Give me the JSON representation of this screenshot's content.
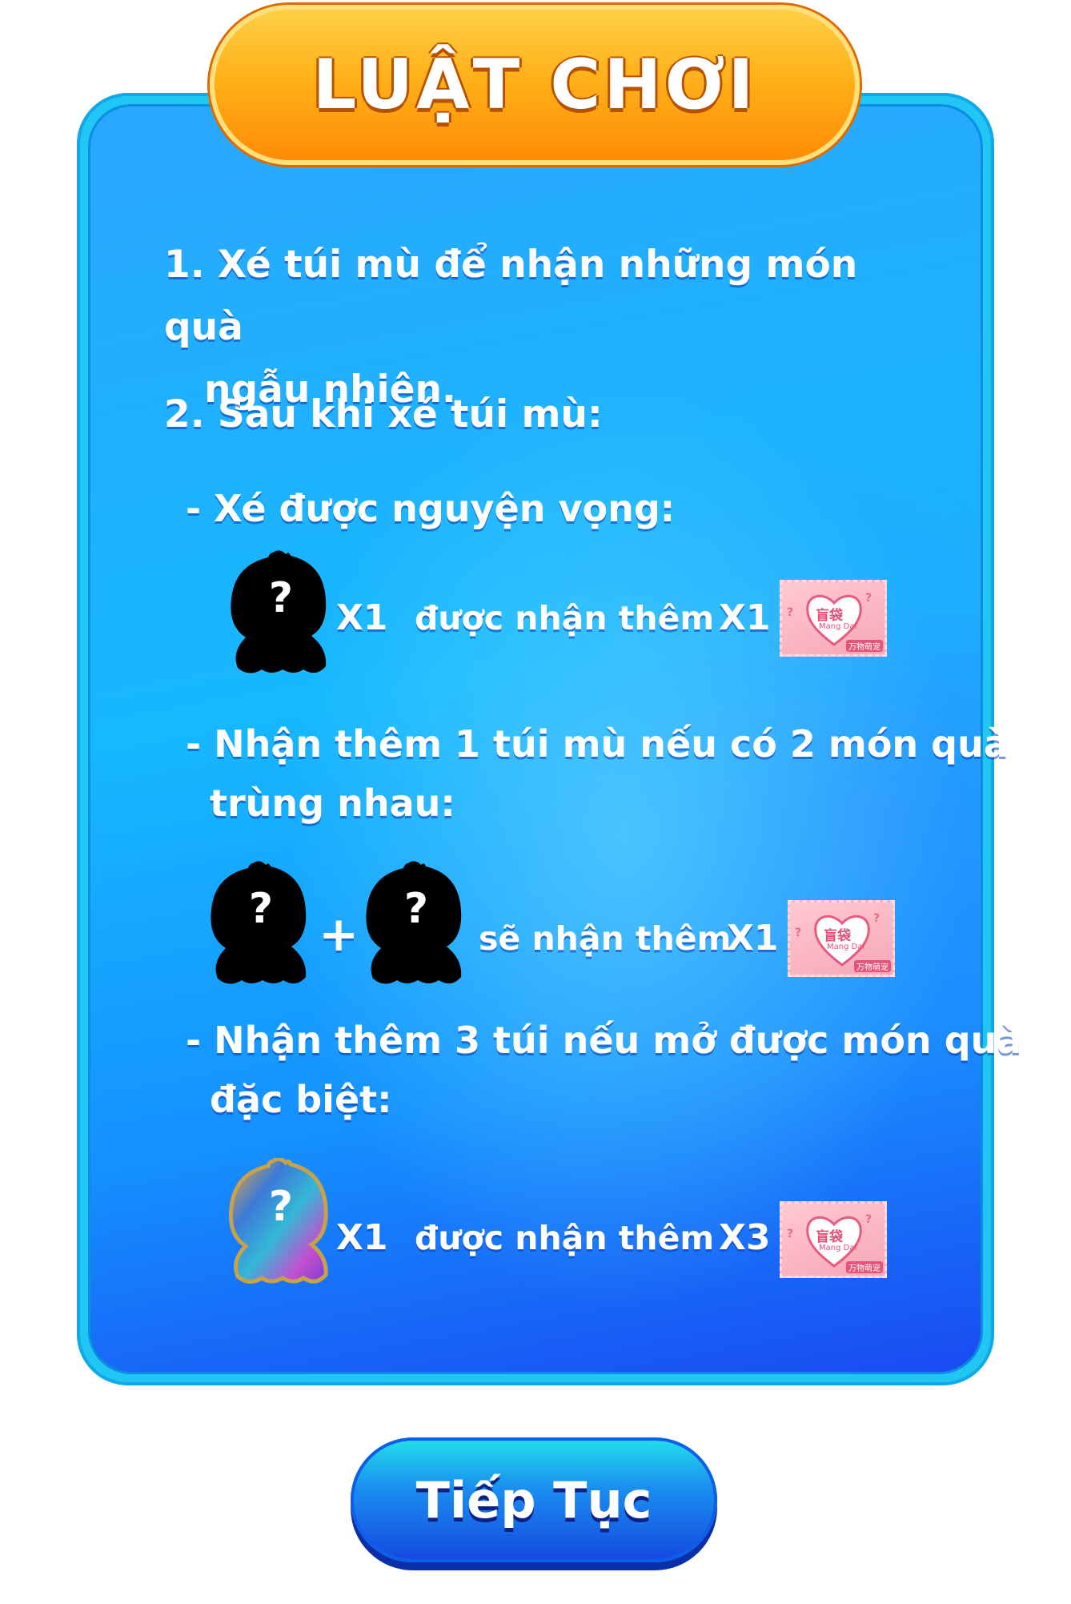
{
  "title": "LUẬT CHƠI",
  "rules": {
    "rule1_line1": "1. Xé túi mù để nhận những món quà",
    "rule1_line2": "ngẫu nhiên.",
    "rule2": "2. Sau khi xé túi mù:",
    "sub1": "- Xé được nguyện vọng:",
    "row1": {
      "count": "X1",
      "text": "được nhận thêm",
      "reward": "X1"
    },
    "sub2_line1": "- Nhận thêm 1 túi mù nếu có 2 món quà",
    "sub2_line2": "trùng nhau:",
    "row2": {
      "plus": "+",
      "text": "sẽ nhận thêm",
      "reward": "X1"
    },
    "sub3_line1": "- Nhận thêm 3 túi nếu mở được món quà",
    "sub3_line2": "đặc biệt:",
    "row3": {
      "count": "X1",
      "text": "được nhận thêm",
      "reward": "X3"
    }
  },
  "bag": {
    "label_cn": "盲袋",
    "label_en": "Mang Dai",
    "label_tag": "万物萌宠"
  },
  "mystery_mark": "?",
  "continue_button": "Tiếp Tục",
  "colors": {
    "panel_blue": "#16b8ff",
    "title_orange": "#ff9a10",
    "button_blue": "#1a6ef0",
    "bag_pink": "#f7a7b6"
  }
}
